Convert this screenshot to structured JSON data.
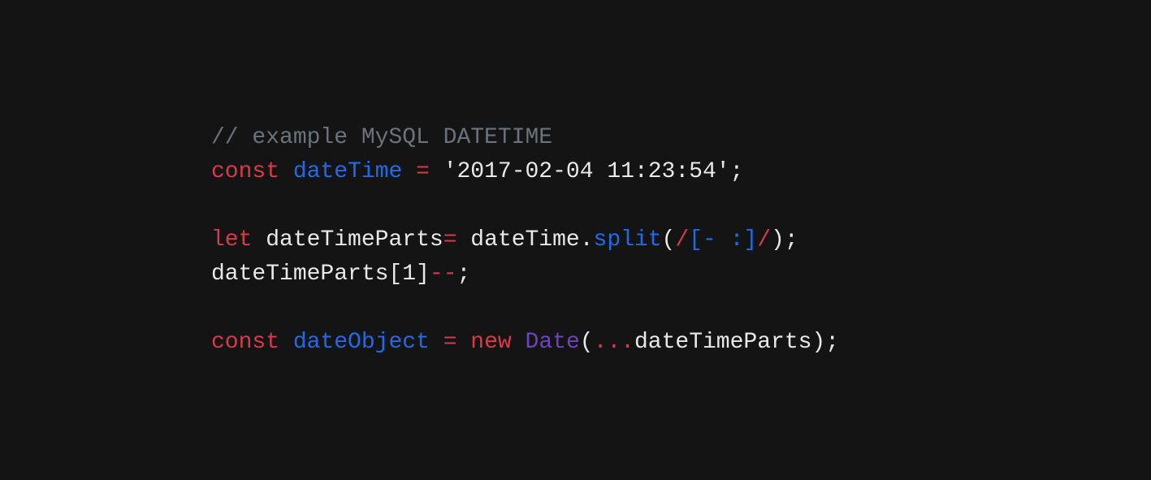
{
  "code": {
    "line1": {
      "comment": "// example MySQL DATETIME"
    },
    "line2": {
      "const": "const",
      "sp1": " ",
      "var": "dateTime",
      "sp2": " ",
      "eq": "=",
      "sp3": " ",
      "str": "'2017-02-04 11:23:54'",
      "semi": ";"
    },
    "line3": "",
    "line4": {
      "let": "let",
      "sp1": " ",
      "var": "dateTimeParts",
      "eq": "=",
      "sp2": " ",
      "obj": "dateTime",
      "dot": ".",
      "method": "split",
      "open": "(",
      "slash1": "/",
      "charclass": "[- :]",
      "slash2": "/",
      "close": ")",
      "semi": ";"
    },
    "line5": {
      "text": "dateTimeParts[",
      "idx": "1",
      "close": "]",
      "dec": "--",
      "semi": ";"
    },
    "line6": "",
    "line7": {
      "const": "const",
      "sp1": " ",
      "var": "dateObject",
      "sp2": " ",
      "eq": "=",
      "sp3": " ",
      "new": "new",
      "sp4": " ",
      "cls": "Date",
      "open": "(",
      "spread": "...",
      "arg": "dateTimeParts",
      "close": ")",
      "semi": ";"
    }
  }
}
